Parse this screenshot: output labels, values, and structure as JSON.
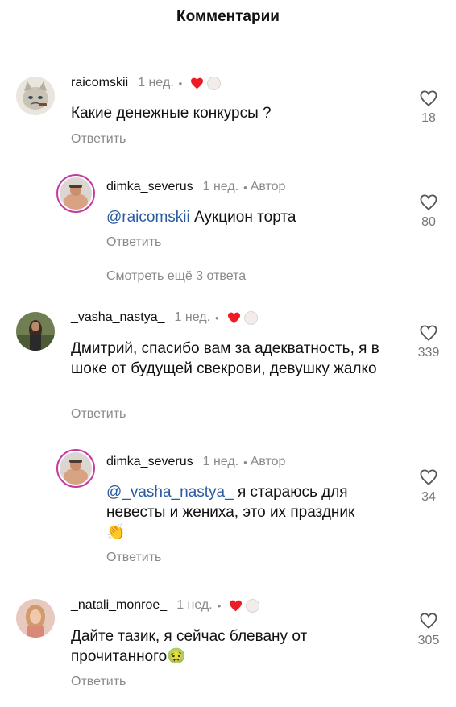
{
  "header": {
    "title": "Комментарии"
  },
  "common": {
    "reply_label": "Ответить",
    "dot": "•"
  },
  "comments": [
    {
      "username": "raicomskii",
      "time": "1 нед.",
      "text": "Какие денежные конкурсы ?",
      "likes": "18"
    },
    {
      "username": "dimka_severus",
      "time": "1 нед.",
      "author": "Автор",
      "mention": "@raicomskii",
      "text": " Аукцион торта",
      "likes": "80",
      "more_replies": "Смотреть ещё 3 ответа"
    },
    {
      "username": "_vasha_nastya_",
      "time": "1 нед.",
      "text": "Дмитрий, спасибо вам за адекватность, я в шоке от будущей свекрови, девушку жалко",
      "likes": "339"
    },
    {
      "username": "dimka_severus",
      "time": "1 нед.",
      "author": "Автор",
      "mention": "@_vasha_nastya_",
      "text": " я стараюсь для невесты и жениха, это их праздник",
      "emoji": "👏",
      "likes": "34"
    },
    {
      "username": "_natali_monroe_",
      "time": "1 нед.",
      "text": "Дайте тазик, я сейчас блевану от прочитанного",
      "emoji": "🤢",
      "likes": "305"
    }
  ],
  "colors": {
    "heart_red": "#ed1c24",
    "mention": "#2a5aa0",
    "story_ring": "#c43ba2"
  }
}
